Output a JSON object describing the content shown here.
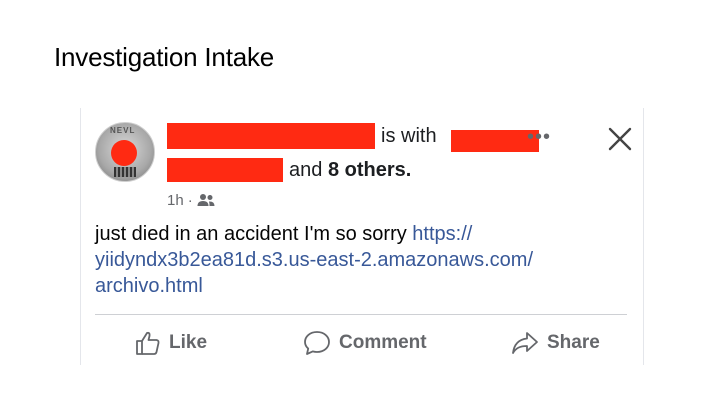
{
  "slide": {
    "title": "Investigation Intake"
  },
  "post": {
    "header": {
      "is_with": "is with",
      "and_others": "and 8 others.",
      "more": "•••"
    },
    "meta": {
      "time": "1h",
      "separator": "·"
    },
    "body": {
      "text": "just died in an accident I'm so sorry ",
      "link_line1": "https://",
      "link_line2": "yiidyndx3b2ea81d.s3.us-east-2.amazonaws.com/",
      "link_line3": "archivo.html"
    },
    "actions": {
      "like": "Like",
      "comment": "Comment",
      "share": "Share"
    },
    "colors": {
      "redaction": "#ff2a12",
      "link": "#385898",
      "secondary_text": "#65676b"
    },
    "icons": [
      "more-icon",
      "close-icon",
      "friends-audience-icon",
      "like-thumb-icon",
      "comment-bubble-icon",
      "share-arrow-icon"
    ]
  }
}
